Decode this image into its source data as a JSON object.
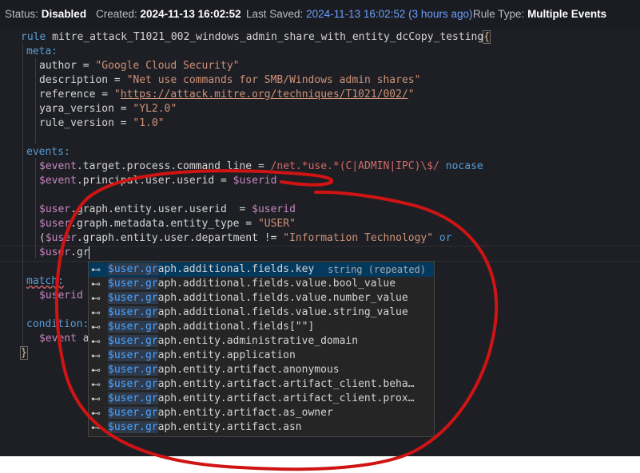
{
  "status": {
    "status_label": "Status:",
    "status_value": "Disabled",
    "created_label": "Created:",
    "created_value": "2024-11-13 16:02:52",
    "saved_label": "Last Saved:",
    "saved_value": "2024-11-13 16:02:52 (3 hours ago)",
    "type_label": "Rule Type:",
    "type_value": "Multiple Events"
  },
  "code": {
    "rule_kw": "rule",
    "rule_name": " mitre_attack_T1021_002_windows_admin_share_with_entity_dcCopy_testing",
    "open_brace": "{",
    "meta": "meta:",
    "author_key": "author = ",
    "author_val": "\"Google Cloud Security\"",
    "desc_key": "description = ",
    "desc_val": "\"Net use commands for SMB/Windows admin shares\"",
    "ref_key": "reference = ",
    "ref_q1": "\"",
    "ref_url": "https://attack.mitre.org/techniques/T1021/002/",
    "ref_q2": "\"",
    "yara_key": "yara_version = ",
    "yara_val": "\"YL2.0\"",
    "rv_key": "rule_version = ",
    "rv_val": "\"1.0\"",
    "events": "events:",
    "e1_a": "$event",
    "e1_b": ".target.process.command_line = ",
    "e1_re": "/net.*use.*(C|ADMIN|IPC)\\$/",
    "e1_nocase": " nocase",
    "e2_a": "$event",
    "e2_b": ".principal.user.userid = ",
    "e2_c": "$userid",
    "e3_a": "$user",
    "e3_b": ".graph.entity.user.userid  = ",
    "e3_c": "$userid",
    "e4_a": "$user",
    "e4_b": ".graph.metadata.entity_type = ",
    "e4_c": "\"USER\"",
    "e5_p": "(",
    "e5_a": "$user",
    "e5_b": ".graph.entity.user.department != ",
    "e5_c": "\"Information Technology\"",
    "e5_or": " or",
    "e6_a": "$user",
    "e6_b": ".gr",
    "match": "match:",
    "m1": "$userid",
    "condition": "condition:",
    "c1_a": "$event",
    "c1_b": " a",
    "close_brace": "}"
  },
  "suggest": {
    "icon": "⊷",
    "prefix": "$user.gr",
    "items": [
      {
        "rest": "aph.additional.fields.key",
        "detail": "string (repeated)"
      },
      {
        "rest": "aph.additional.fields.value.bool_value"
      },
      {
        "rest": "aph.additional.fields.value.number_value"
      },
      {
        "rest": "aph.additional.fields.value.string_value"
      },
      {
        "rest": "aph.additional.fields[\"\"]"
      },
      {
        "rest": "aph.entity.administrative_domain"
      },
      {
        "rest": "aph.entity.application"
      },
      {
        "rest": "aph.entity.artifact.anonymous"
      },
      {
        "rest": "aph.entity.artifact.artifact_client.beha…"
      },
      {
        "rest": "aph.entity.artifact.artifact_client.prox…"
      },
      {
        "rest": "aph.entity.artifact.as_owner"
      },
      {
        "rest": "aph.entity.artifact.asn"
      }
    ]
  },
  "colors": {
    "annotation": "#d01414",
    "selection": "#04395e",
    "match_highlight": "#4aa3ff"
  }
}
